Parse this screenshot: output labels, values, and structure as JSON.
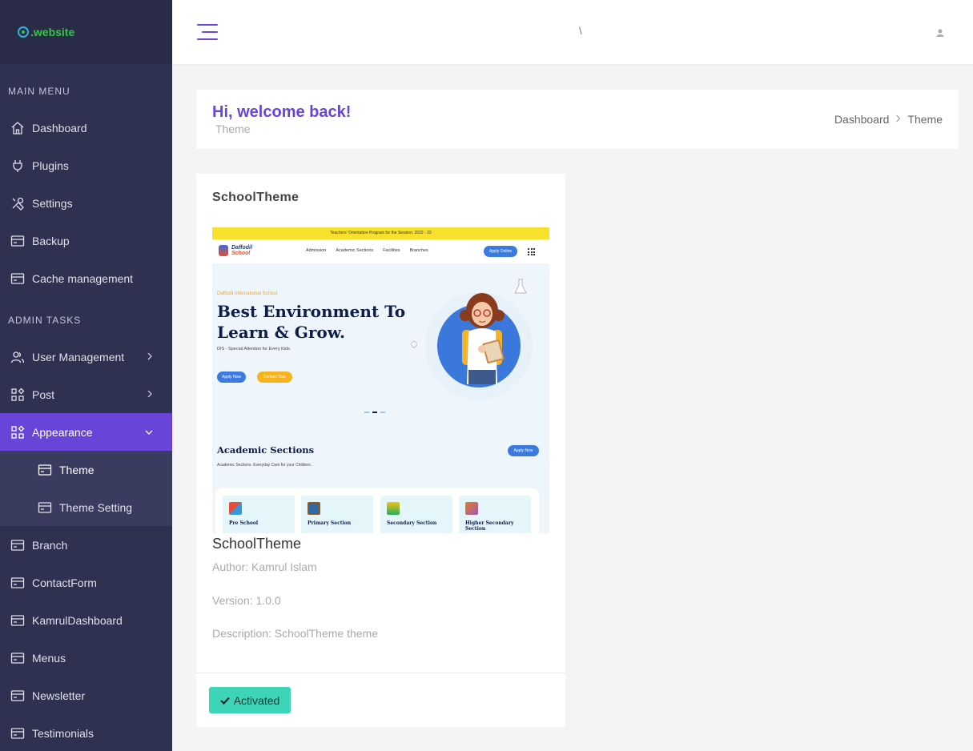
{
  "brand": {
    "name": ".website"
  },
  "sidebar": {
    "main_menu_heading": "MAIN MENU",
    "main_items": [
      {
        "label": "Dashboard",
        "icon": "home-icon"
      },
      {
        "label": "Plugins",
        "icon": "plug-icon"
      },
      {
        "label": "Settings",
        "icon": "tools-icon"
      },
      {
        "label": "Backup",
        "icon": "card-icon"
      },
      {
        "label": "Cache management",
        "icon": "card-icon"
      }
    ],
    "admin_tasks_heading": "ADMIN TASKS",
    "admin_items": [
      {
        "label": "User Management",
        "icon": "users-icon",
        "expandable": true
      },
      {
        "label": "Post",
        "icon": "grid-icon",
        "expandable": true
      },
      {
        "label": "Appearance",
        "icon": "grid-icon",
        "expandable": true,
        "active": true
      }
    ],
    "appearance_sub": [
      {
        "label": "Theme",
        "icon": "card-icon",
        "current": true
      },
      {
        "label": "Theme Setting",
        "icon": "card-icon"
      }
    ],
    "more_items": [
      {
        "label": "Branch",
        "icon": "card-icon"
      },
      {
        "label": "ContactForm",
        "icon": "card-icon"
      },
      {
        "label": "KamrulDashboard",
        "icon": "card-icon"
      },
      {
        "label": "Menus",
        "icon": "card-icon"
      },
      {
        "label": "Newsletter",
        "icon": "card-icon"
      },
      {
        "label": "Testimonials",
        "icon": "card-icon"
      }
    ]
  },
  "header": {
    "separator": "\\"
  },
  "page": {
    "welcome": "Hi, welcome back!",
    "subtitle": "Theme",
    "breadcrumb": [
      "Dashboard",
      "Theme"
    ]
  },
  "theme": {
    "card_title": "SchoolTheme",
    "name": "SchoolTheme",
    "author": "Author: Kamrul Islam",
    "version": "Version: 1.0.0",
    "description": "Description: SchoolTheme theme",
    "button_label": "Activated"
  },
  "preview": {
    "top_strip": "Teachers' Orientation Program for the Session: 2022 - 23",
    "logo_line1": "Daffodil",
    "logo_line2": "School",
    "nav_links": [
      "Admission",
      "Academic Sections",
      "Facilities",
      "Branches"
    ],
    "apply_online": "Apply Online",
    "tag": "Daffodil International School",
    "headline_1": "Best Environment To",
    "headline_2": "Learn & Grow.",
    "lead": "DIS - Special Attention for Every Kids.",
    "btn_apply": "Apply Now",
    "btn_contact": "Contact Tour",
    "section_title": "Academic Sections",
    "section_sub": "Academic Sections. Everyday Care for your Children.",
    "section_btn": "Apply Now",
    "cards": [
      "Pre School",
      "Primary Section",
      "Secondary Section",
      "Higher Secondary Section"
    ]
  },
  "colors": {
    "sidebar_bg": "#2f3150",
    "accent": "#6844d8",
    "success": "#3dd5b8"
  }
}
